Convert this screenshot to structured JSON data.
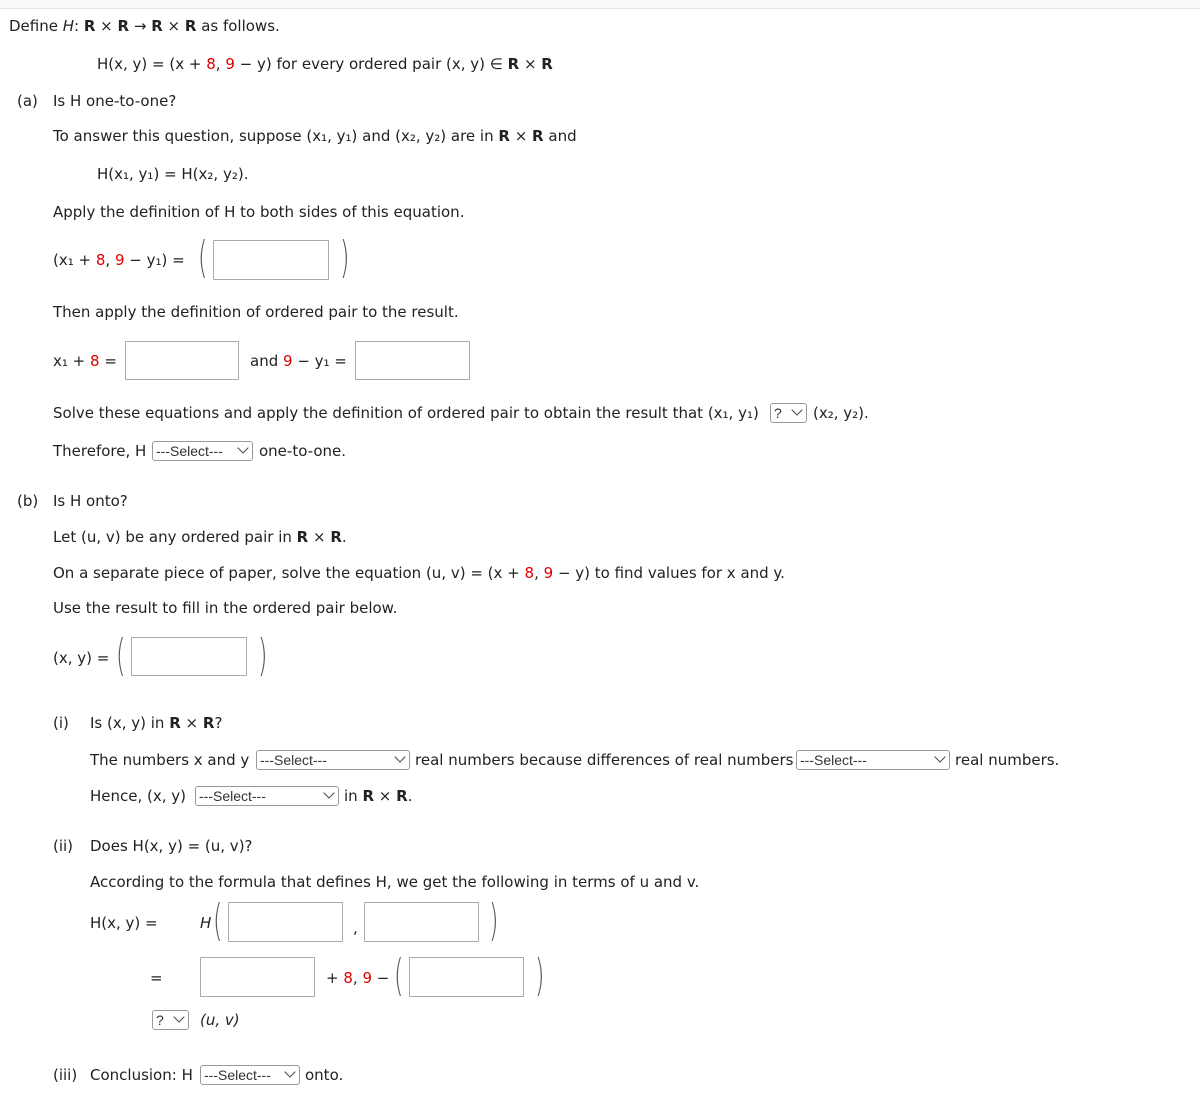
{
  "intro": {
    "define": "Define ",
    "H": "H",
    "mapping_rest": ": ",
    "R": "R",
    "times": " × ",
    "arrow": " → ",
    "as_follows": " as follows.",
    "formula_prefix": "H(x, y) = (x + ",
    "c8": "8",
    "comma": ", ",
    "c9": "9",
    "formula_suffix": " − y) for every ordered pair (x, y) ∈ "
  },
  "part_a": {
    "label": "(a)",
    "question": "Is H one-to-one?",
    "suppose_text": "To answer this question, suppose (x₁, y₁) and (x₂, y₂) are in ",
    "suppose_and": " and",
    "equation": "H(x₁, y₁) = H(x₂, y₂).",
    "apply_text": "Apply the definition of H to both sides of this equation.",
    "lhs_prefix": "(x₁ + ",
    "lhs_mid": " − y₁) =",
    "then_text": "Then apply the definition of ordered pair to the result.",
    "eq1_prefix": "x₁ + ",
    "eq1_suffix": " =",
    "and_word": "and ",
    "eq2_suffix": " − y₁ =",
    "solve_text": "Solve these equations and apply the definition of ordered pair to obtain the result that (x₁, y₁)",
    "solve_select": "?",
    "solve_end": "(x₂, y₂).",
    "therefore": "Therefore, H",
    "therefore_select": "---Select---",
    "therefore_end": "one-to-one."
  },
  "part_b": {
    "label": "(b)",
    "question": "Is H onto?",
    "let_text": "Let (u, v) be any ordered pair in ",
    "solve_text_prefix": "On a separate piece of paper, solve the equation (u, v) = (x + ",
    "solve_text_suffix": " − y) to find values for x and y.",
    "use_text": "Use the result to fill in the ordered pair below.",
    "xy_eq": "(x, y) =",
    "i_label": "(i)",
    "i_question_prefix": "Is (x, y) in ",
    "numbers_prefix": "The numbers x and y",
    "numbers_select": "---Select---",
    "numbers_mid": "real numbers because differences of real numbers",
    "diff_select": "---Select---",
    "numbers_end": "real numbers.",
    "hence_prefix": "Hence, (x, y)",
    "hence_select": "---Select---",
    "hence_end": "in ",
    "ii_label": "(ii)",
    "ii_question": "Does H(x, y) = (u, v)?",
    "according_text": "According to the formula that defines H, we get the following in terms of u and v.",
    "hxy_eq": "H(x, y)  =",
    "H_letter": "H",
    "comma": ",",
    "eq_sign": "=",
    "plus_text": "+ ",
    "minus_text": " −",
    "cmp_select": "?",
    "uv": "(u, v)",
    "iii_label": "(iii)",
    "conclusion_prefix": "Conclusion: H",
    "conclusion_select": "---Select---",
    "conclusion_end": "onto."
  }
}
